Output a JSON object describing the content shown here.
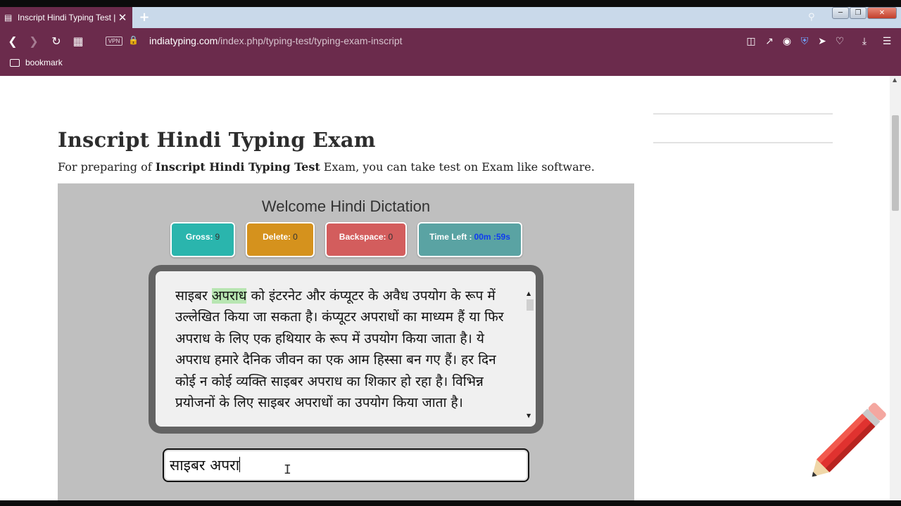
{
  "browser": {
    "tab_title": "Inscript Hindi Typing Test |",
    "url_host": "indiatyping.com",
    "url_path": "/index.php/typing-test/typing-exam-inscript",
    "vpn_label": "VPN",
    "bookmark_label": "bookmark"
  },
  "page": {
    "heading": "Inscript Hindi Typing Exam",
    "intro_prefix": "For preparing of ",
    "intro_bold": "Inscript Hindi Typing Test",
    "intro_suffix": " Exam, you can take test on Exam like software."
  },
  "exam": {
    "title": "Welcome Hindi Dictation",
    "stats": {
      "gross_label": "Gross:",
      "gross_value": "9",
      "delete_label": "Delete:",
      "delete_value": "0",
      "backspace_label": "Backspace:",
      "backspace_value": "0",
      "time_label": "Time Left :",
      "time_value": "00m :59s"
    },
    "stat_colors": {
      "gross": "#2ab5ad",
      "delete": "#d5921d",
      "backspace": "#d35d5d",
      "time": "#5aa3a3"
    },
    "passage": {
      "before": "साइबर ",
      "highlight": "अपराध",
      "after": " को इंटरनेट और कंप्यूटर के अवैध उपयोग के रूप में उल्लेखित किया जा सकता है। कंप्यूटर अपराधों का माध्यम हैं या फिर अपराध के लिए एक हथियार के रूप में उपयोग किया जाता है। ये अपराध हमारे दैनिक जीवन का एक आम हिस्सा बन गए हैं। हर दिन कोई न कोई व्यक्ति साइबर अपराध का शिकार हो रहा है। विभिन्न प्रयोजनों के लिए साइबर अपराधों का उपयोग किया जाता है।"
    },
    "typed_text": "साइबर अपरा",
    "highlight_color": "#b8e6b2"
  },
  "icons": {
    "tab_favicon": "typewriter-icon",
    "tab_close": "close-icon",
    "new_tab": "plus-icon",
    "back": "back-arrow-icon",
    "forward": "forward-arrow-icon",
    "reload": "reload-icon",
    "grid": "speed-dial-icon",
    "lock": "lock-icon",
    "reader": "reader-view-icon",
    "share": "share-icon",
    "snapshot": "camera-icon",
    "shield": "shield-icon",
    "send": "send-icon",
    "heart": "heart-icon",
    "download": "download-icon",
    "menu": "menu-icon",
    "decor": "pencil-icon"
  },
  "colors": {
    "browser_chrome": "#6b2b4c",
    "tabbar": "#c9d9ea",
    "exam_bg": "#bfbfbf"
  }
}
